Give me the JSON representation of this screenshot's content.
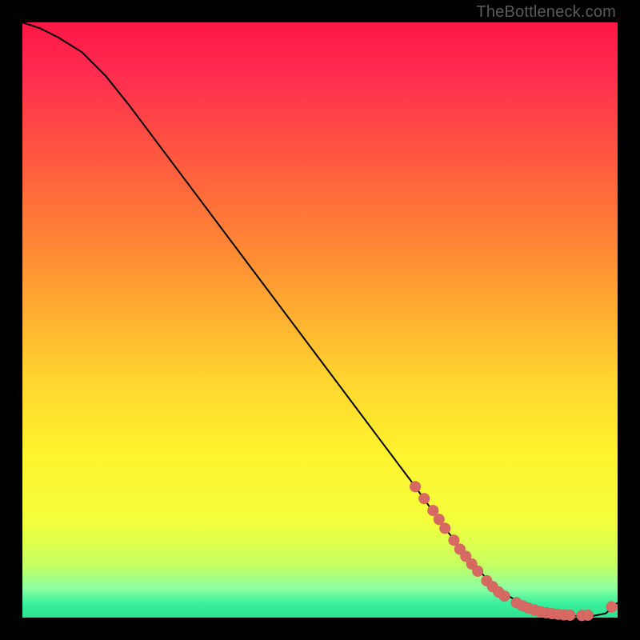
{
  "watermark": "TheBottleneck.com",
  "colors": {
    "dot": "#d66a63",
    "curve": "#000000",
    "background_border": "#000000"
  },
  "chart_data": {
    "type": "line",
    "title": "",
    "xlabel": "",
    "ylabel": "",
    "xlim": [
      0,
      100
    ],
    "ylim": [
      0,
      100
    ],
    "grid": false,
    "legend": false,
    "series": [
      {
        "name": "bottleneck-curve",
        "x": [
          0,
          3,
          6,
          10,
          14,
          18,
          24,
          30,
          36,
          42,
          48,
          54,
          60,
          66,
          71,
          75,
          78,
          81,
          84,
          86,
          88,
          90,
          92,
          94,
          96,
          98,
          100
        ],
        "y": [
          100,
          99,
          97.5,
          95,
          91,
          86,
          78,
          70,
          62,
          54,
          46,
          38,
          30,
          22,
          15,
          10,
          6.5,
          4,
          2.3,
          1.3,
          0.8,
          0.5,
          0.3,
          0.2,
          0.3,
          0.7,
          2.5
        ]
      }
    ],
    "scatter_points": {
      "name": "highlighted-points",
      "points": [
        {
          "x": 66,
          "y": 22
        },
        {
          "x": 67.5,
          "y": 20
        },
        {
          "x": 69,
          "y": 18
        },
        {
          "x": 70,
          "y": 16.5
        },
        {
          "x": 71,
          "y": 15
        },
        {
          "x": 72.5,
          "y": 13
        },
        {
          "x": 73.5,
          "y": 11.5
        },
        {
          "x": 74.5,
          "y": 10.3
        },
        {
          "x": 75.5,
          "y": 9
        },
        {
          "x": 76.5,
          "y": 7.8
        },
        {
          "x": 78,
          "y": 6.2
        },
        {
          "x": 79,
          "y": 5.2
        },
        {
          "x": 80,
          "y": 4.3
        },
        {
          "x": 81,
          "y": 3.6
        },
        {
          "x": 83,
          "y": 2.5
        },
        {
          "x": 84,
          "y": 2.0
        },
        {
          "x": 85,
          "y": 1.6
        },
        {
          "x": 86,
          "y": 1.3
        },
        {
          "x": 87,
          "y": 1.0
        },
        {
          "x": 88,
          "y": 0.8
        },
        {
          "x": 89,
          "y": 0.65
        },
        {
          "x": 90,
          "y": 0.55
        },
        {
          "x": 91,
          "y": 0.45
        },
        {
          "x": 92,
          "y": 0.4
        },
        {
          "x": 94,
          "y": 0.35
        },
        {
          "x": 95,
          "y": 0.4
        },
        {
          "x": 99,
          "y": 1.8
        }
      ]
    }
  }
}
